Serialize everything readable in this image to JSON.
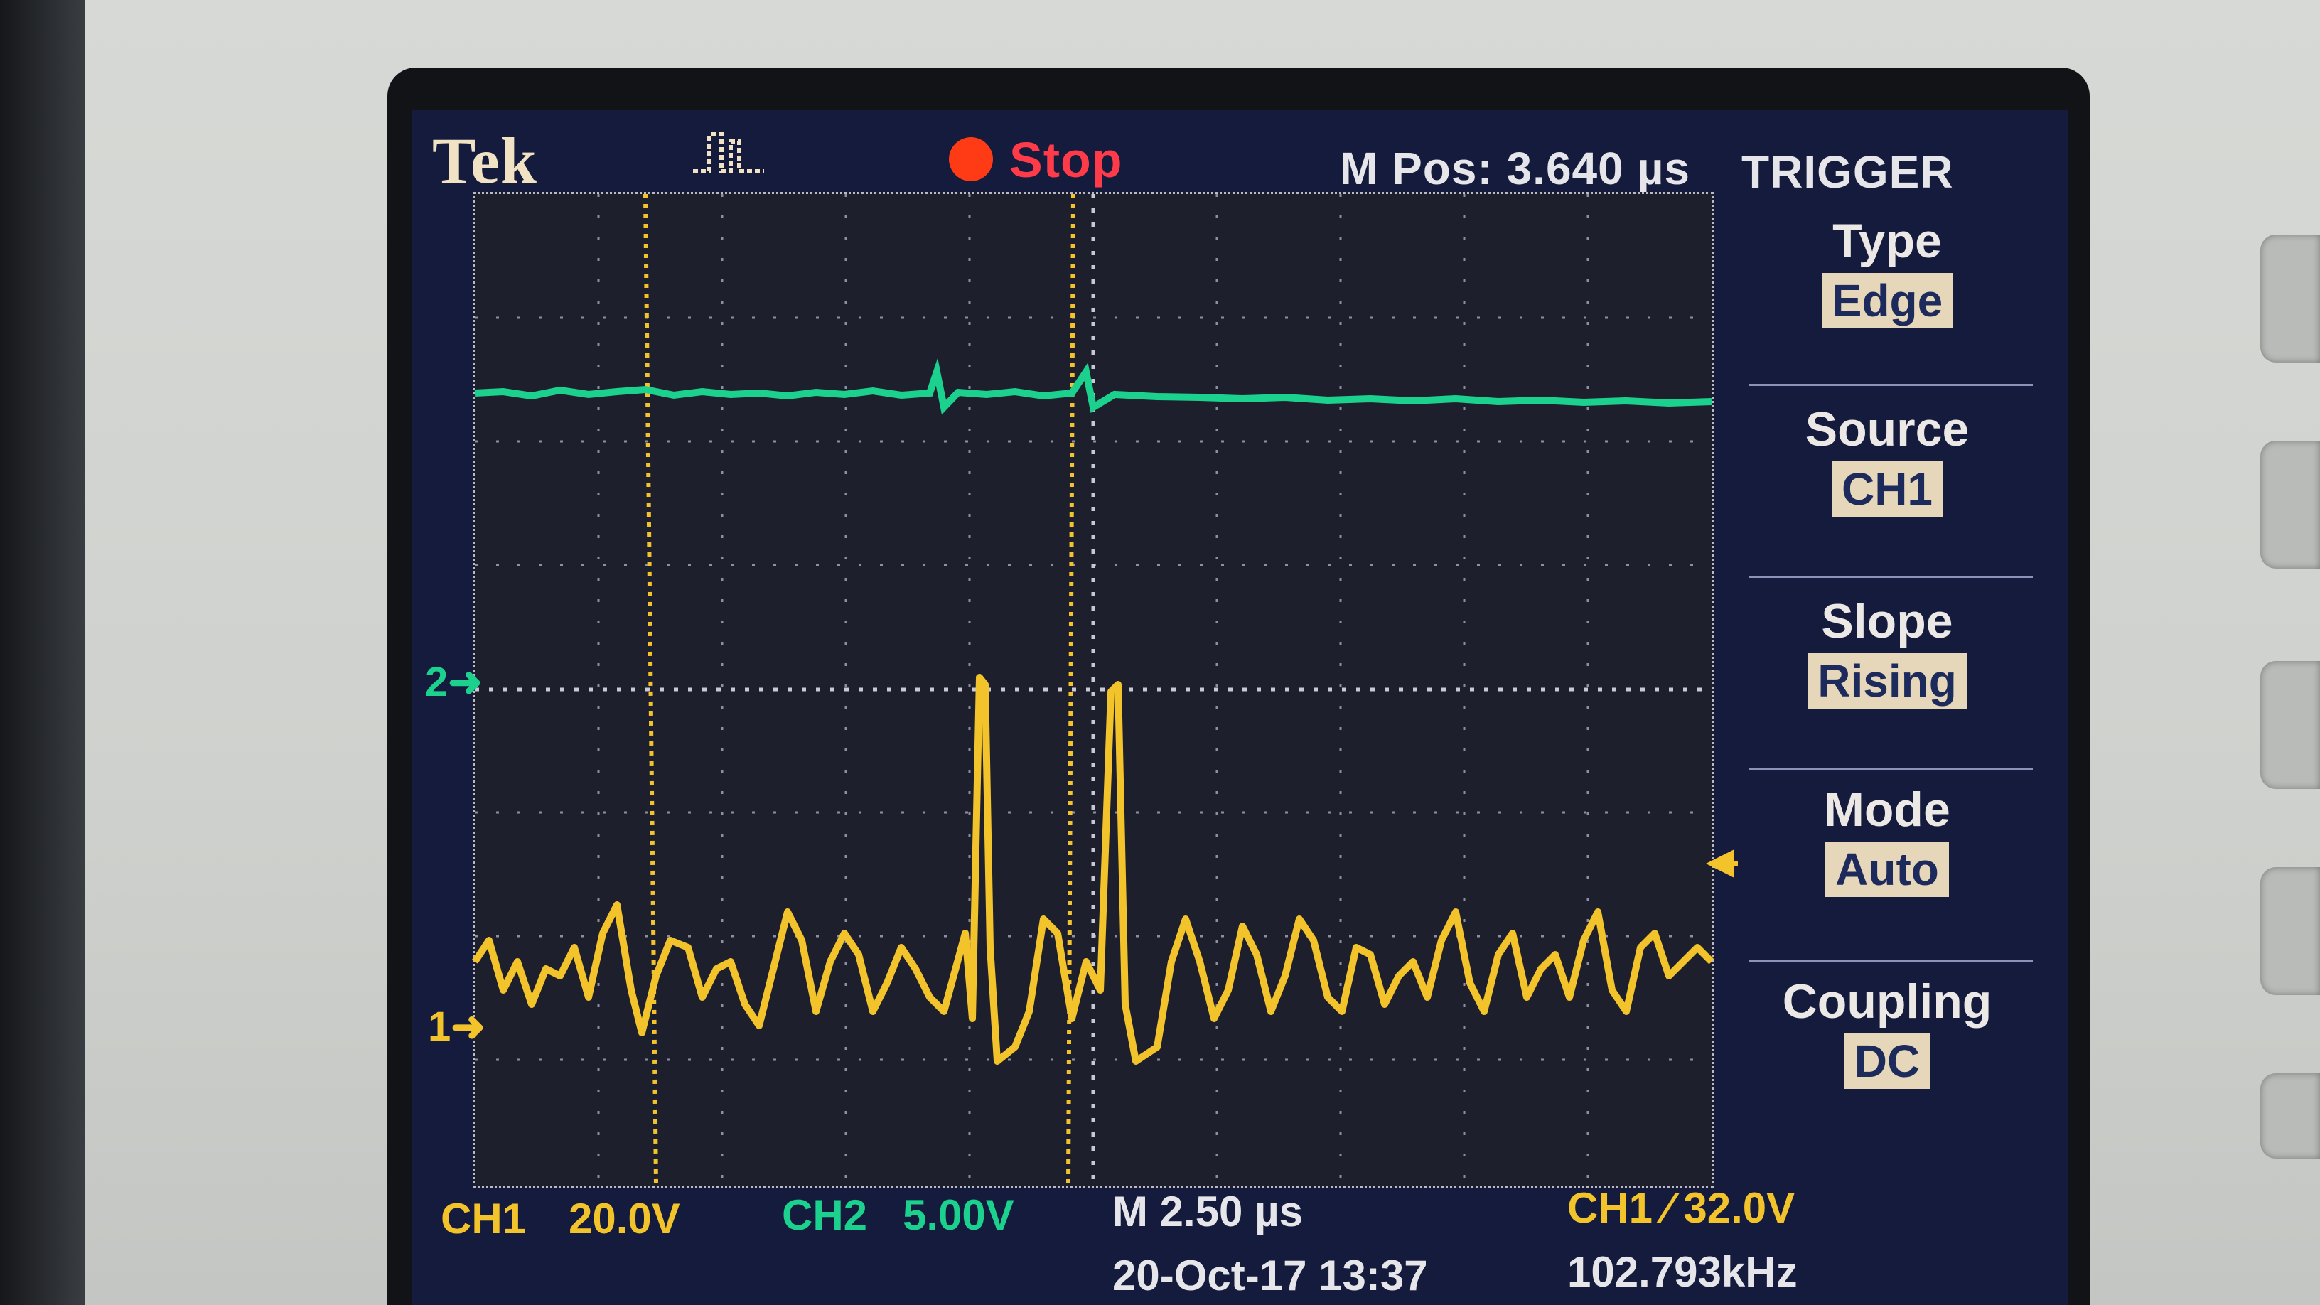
{
  "header": {
    "brand": "Tek",
    "acquisition_state": "Stop",
    "m_pos_label": "M Pos: 3.640 µs",
    "trigger_title": "TRIGGER"
  },
  "trigger_menu": [
    {
      "label": "Type",
      "value": "Edge"
    },
    {
      "label": "Source",
      "value": "CH1"
    },
    {
      "label": "Slope",
      "value": "Rising"
    },
    {
      "label": "Mode",
      "value": "Auto"
    },
    {
      "label": "Coupling",
      "value": "DC"
    }
  ],
  "channel_markers": {
    "ch2": "2",
    "ch1": "1"
  },
  "status_bar": {
    "ch1_label": "CH1",
    "ch1_scale": "20.0V",
    "ch2_label": "CH2",
    "ch2_scale": "5.00V",
    "timebase": "M 2.50 µs",
    "trigger_summary": "CH1 ⁄ 32.0V",
    "date_time": "20-Oct-17 13:37",
    "frequency": "102.793kHz"
  },
  "colors": {
    "ch1": "#f3c32c",
    "ch2": "#1cd18e",
    "screen_bg": "#141b3c",
    "menu_value_bg": "#e7d7ba"
  }
}
